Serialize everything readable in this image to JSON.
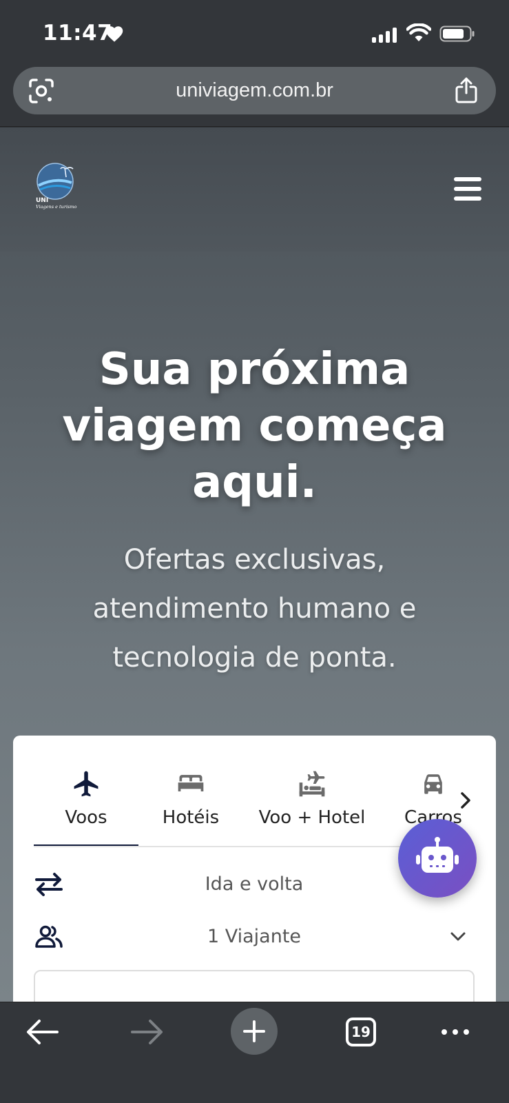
{
  "status_bar": {
    "time": "11:47"
  },
  "browser": {
    "url": "univiagem.com.br",
    "tab_count": "19"
  },
  "site": {
    "logo_text": "UNI Viagens e Turismo"
  },
  "hero": {
    "title_lines": [
      "Sua próxima",
      "viagem começa",
      "aqui."
    ],
    "subtitle_lines": [
      "Ofertas exclusivas,",
      "atendimento humano e",
      "tecnologia de ponta."
    ]
  },
  "search": {
    "tabs": [
      {
        "label": "Voos",
        "icon": "plane-icon",
        "active": true
      },
      {
        "label": "Hotéis",
        "icon": "bed-icon",
        "active": false
      },
      {
        "label": "Voo + Hotel",
        "icon": "flight-hotel-icon",
        "active": false
      },
      {
        "label": "Carros",
        "icon": "car-icon",
        "active": false
      }
    ],
    "trip_type": "Ida e volta",
    "travelers": "1 Viajante"
  },
  "colors": {
    "accent": "#101a3a",
    "bot_gradient_start": "#5a5fd6",
    "bot_gradient_end": "#7a4fc2"
  }
}
